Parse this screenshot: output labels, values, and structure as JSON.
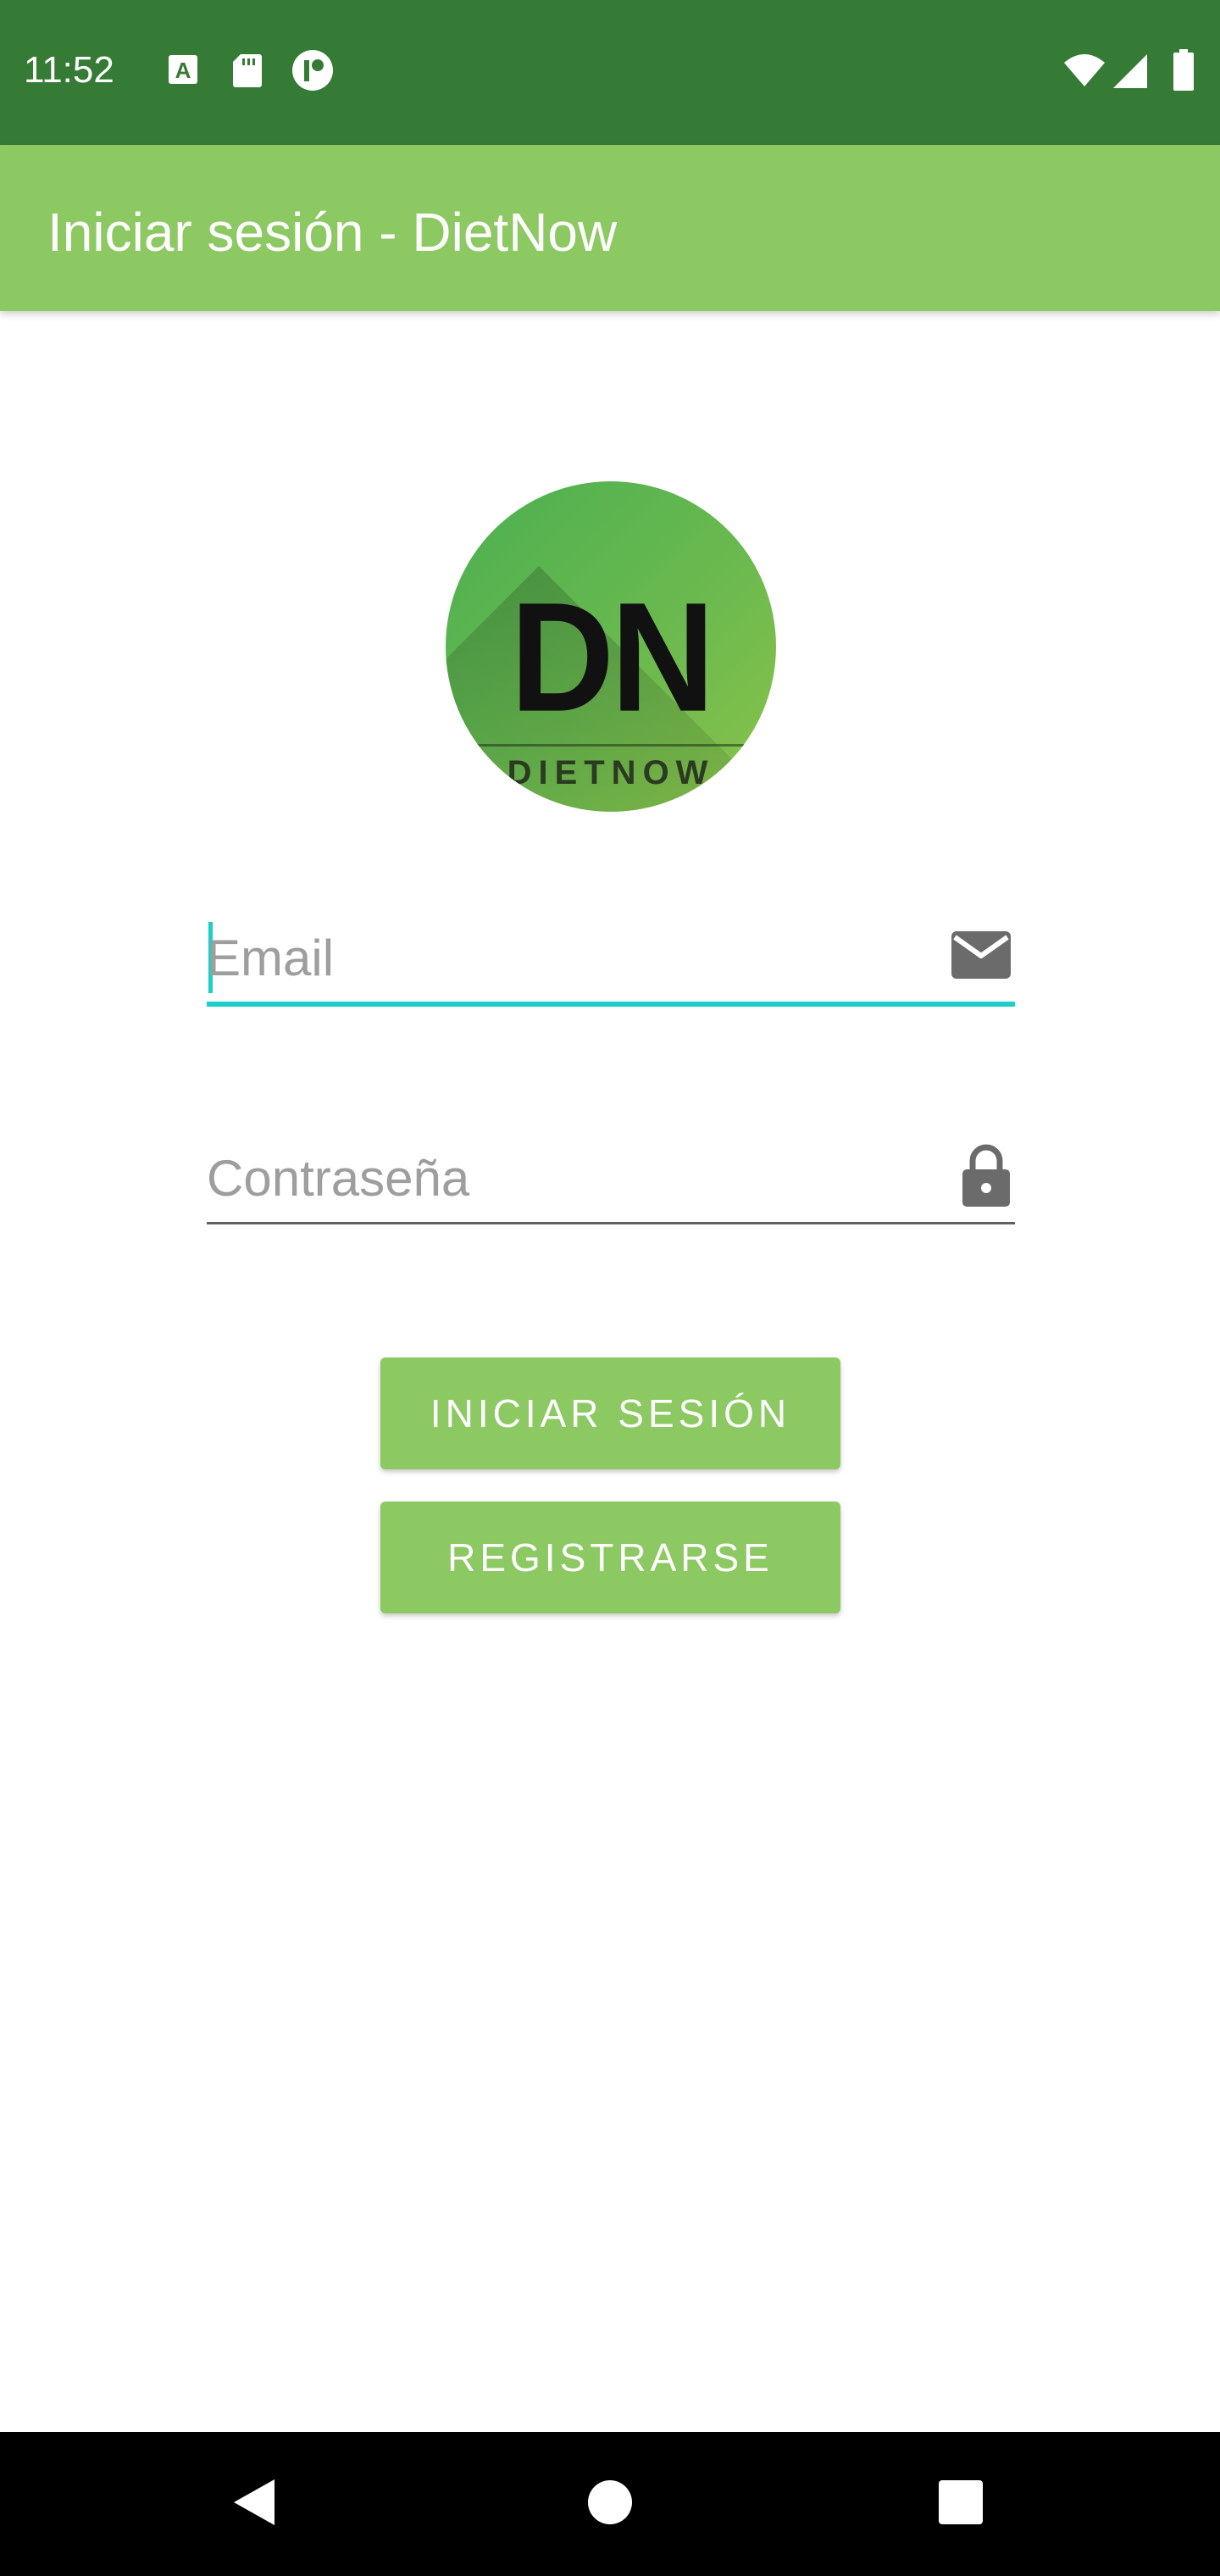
{
  "status_bar": {
    "time": "11:52",
    "icons": [
      "font-a-icon",
      "sd-card-icon",
      "app-notification-icon",
      "wifi-icon",
      "signal-icon",
      "battery-icon"
    ]
  },
  "app_bar": {
    "title": "Iniciar sesión - DietNow"
  },
  "logo": {
    "letters": "DN",
    "wordmark": "DIETNOW"
  },
  "form": {
    "email": {
      "value": "",
      "placeholder": "Email",
      "icon": "envelope-icon"
    },
    "password": {
      "value": "",
      "placeholder": "Contraseña",
      "icon": "lock-icon"
    }
  },
  "buttons": {
    "login_label": "INICIAR SESIÓN",
    "register_label": "REGISTRARSE"
  },
  "nav_bar": {
    "buttons": [
      "back-icon",
      "home-icon",
      "recents-icon"
    ]
  },
  "colors": {
    "status_bar": "#357b35",
    "app_bar": "#8cc962",
    "accent": "#1ccfc9",
    "button": "#8cc962"
  }
}
